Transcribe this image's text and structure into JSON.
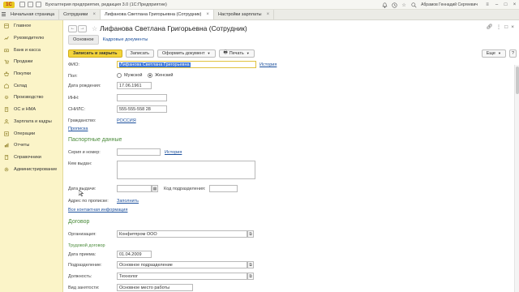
{
  "window": {
    "logo": "1С",
    "title": "Бухгалтерия предприятия, редакция 3.0   (1С:Предприятие)",
    "user": "Абрамов Геннадий Сергеевич"
  },
  "tabs": [
    {
      "label": "Начальная страница",
      "closable": false,
      "active": false
    },
    {
      "label": "Сотрудники",
      "closable": true,
      "active": false
    },
    {
      "label": "Лифанова Светлана Григорьевна (Сотрудник)",
      "closable": true,
      "active": true
    },
    {
      "label": "Настройки зарплаты",
      "closable": true,
      "active": false
    }
  ],
  "sidebar": {
    "items": [
      {
        "label": "Главное",
        "icon": "home-icon"
      },
      {
        "label": "Руководителю",
        "icon": "chart-icon"
      },
      {
        "label": "Банк и касса",
        "icon": "bank-icon"
      },
      {
        "label": "Продажи",
        "icon": "cart-icon"
      },
      {
        "label": "Покупки",
        "icon": "basket-icon"
      },
      {
        "label": "Склад",
        "icon": "warehouse-icon"
      },
      {
        "label": "Производство",
        "icon": "gear-icon"
      },
      {
        "label": "ОС и НМА",
        "icon": "building-icon"
      },
      {
        "label": "Зарплата и кадры",
        "icon": "people-icon"
      },
      {
        "label": "Операции",
        "icon": "operations-icon"
      },
      {
        "label": "Отчеты",
        "icon": "report-icon"
      },
      {
        "label": "Справочники",
        "icon": "book-icon"
      },
      {
        "label": "Администрирование",
        "icon": "settings-icon"
      }
    ]
  },
  "header": {
    "title": "Лифанова Светлана Григорьевна (Сотрудник)",
    "subtabs": {
      "main": "Основное",
      "docs": "Кадровые документы"
    }
  },
  "toolbar": {
    "save_close": "Записать и закрыть",
    "save": "Записать",
    "create_doc": "Оформить документ",
    "print": "Печать",
    "more": "Еще",
    "help": "?"
  },
  "form": {
    "fio_label": "ФИО:",
    "fio_value": "Лифанова Светлана Григорьевна",
    "history": "История",
    "gender_label": "Пол:",
    "gender_male": "Мужской",
    "gender_female": "Женский",
    "gender_selected": "female",
    "birth_label": "Дата рождения:",
    "birth_value": "17.06.1961",
    "inn_label": "ИНН:",
    "inn_value": "",
    "snils_label": "СНИЛС:",
    "snils_value": "555-555-558 28",
    "citizenship_label": "Гражданство:",
    "citizenship_value": "РОССИЯ",
    "propiska_link": "Прописка",
    "passport_section": "Паспортные данные",
    "series_label": "Серия и номер:",
    "series_value": "",
    "passport_history": "История",
    "issued_by_label": "Кем выдан:",
    "issued_by_value": "",
    "issue_date_label": "Дата выдачи:",
    "issue_date_value": "",
    "dept_code_label": "Код подразделения:",
    "dept_code_value": "",
    "address_label": "Адрес по прописке:",
    "address_fill": "Заполнить",
    "all_contacts": "Все контактная информация",
    "contract_section": "Договор",
    "org_label": "Организация:",
    "org_value": "Конфитпром ООО",
    "labor_contract": "Трудовой договор",
    "hire_date_label": "Дата приема:",
    "hire_date_value": "01.04.2009",
    "subdivision_label": "Подразделение:",
    "subdivision_value": "Основное подразделение",
    "position_label": "Должность:",
    "position_value": "Технолог",
    "work_type_label": "Вид занятости:",
    "work_type_value": "Основное место работы"
  }
}
